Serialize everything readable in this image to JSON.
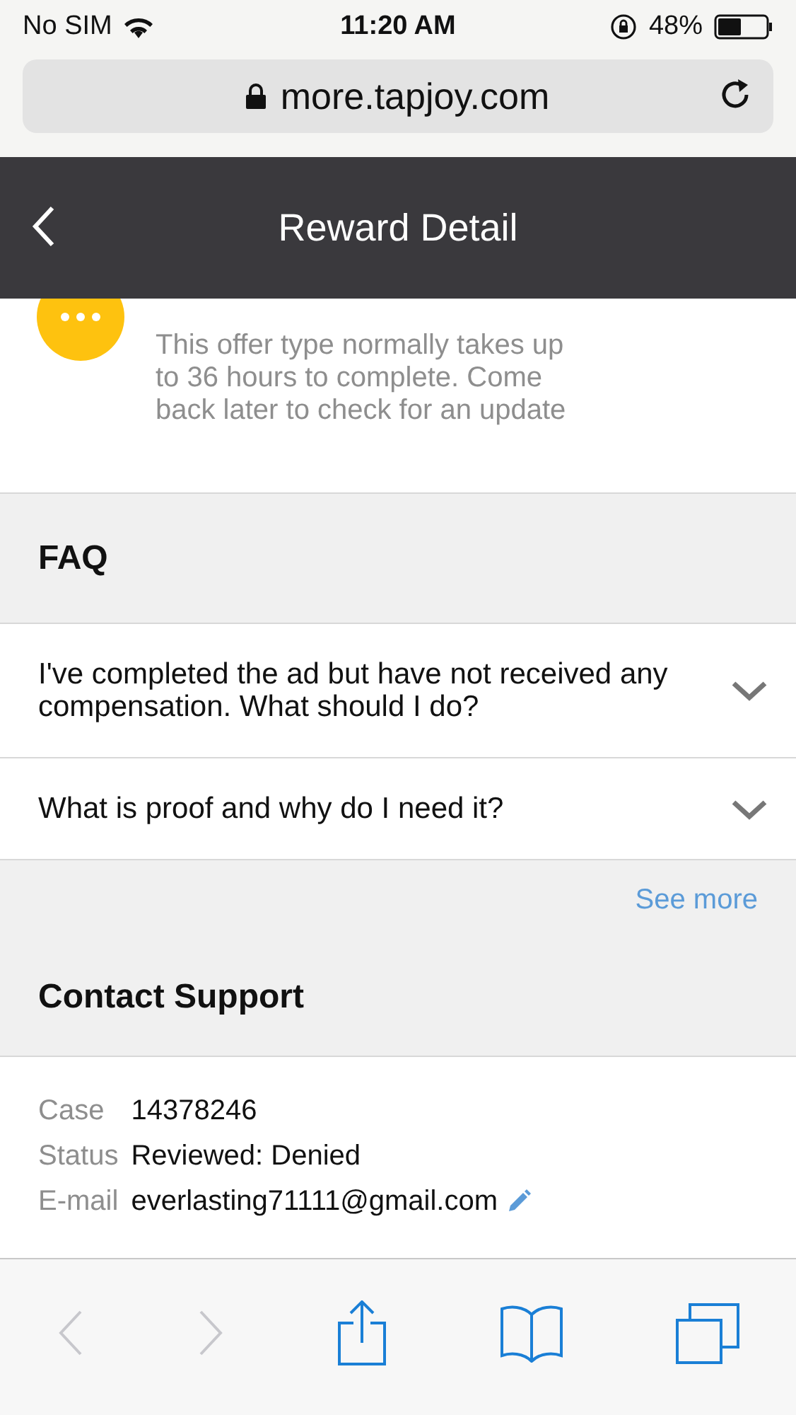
{
  "status_bar": {
    "carrier": "No SIM",
    "time": "11:20 AM",
    "battery": "48%"
  },
  "address_bar": {
    "url": "more.tapjoy.com"
  },
  "nav_bar": {
    "title": "Reward Detail"
  },
  "pending": {
    "message": "This offer type normally takes up to 36 hours to complete. Come back later to check for an update"
  },
  "faq": {
    "title": "FAQ",
    "items": [
      {
        "question": "I've completed the ad but have not received any compensation. What should I do?",
        "expanded": false
      },
      {
        "question": "What is proof and why do I need it?",
        "expanded": false
      }
    ],
    "see_more": "See more"
  },
  "contact": {
    "title": "Contact Support",
    "fields": [
      {
        "label": "Case",
        "value": "14378246",
        "editable": false
      },
      {
        "label": "Status",
        "value": "Reviewed: Denied",
        "editable": false
      },
      {
        "label": "E-mail",
        "value": "everlasting71111@gmail.com",
        "editable": true
      }
    ]
  },
  "toolbar": {
    "back_disabled": true,
    "forward_disabled": true
  }
}
